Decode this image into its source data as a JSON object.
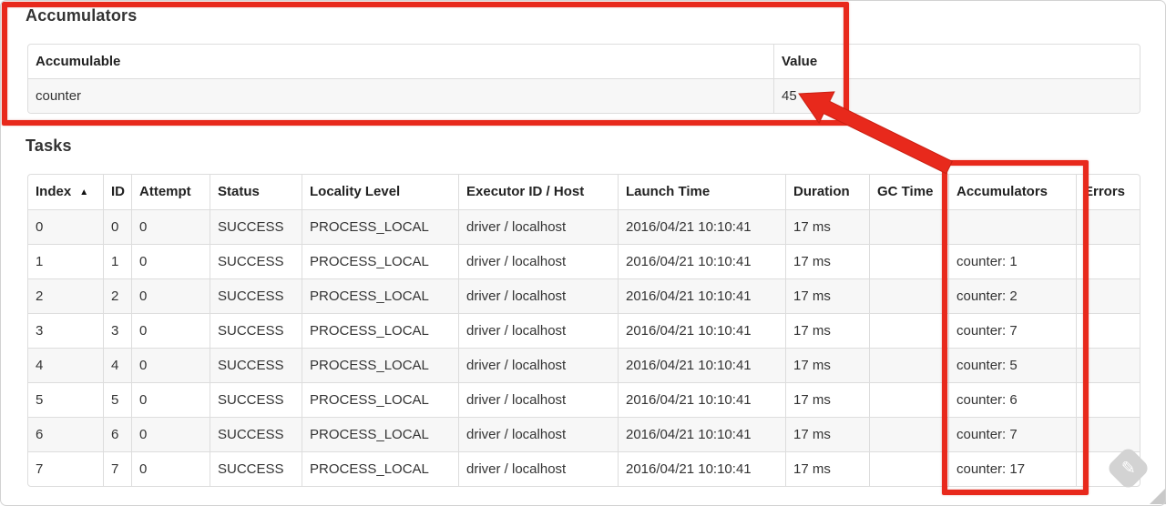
{
  "annotation_color": "#e8291c",
  "accumulators_section": {
    "title": "Accumulators",
    "table": {
      "columns": [
        "Accumulable",
        "Value"
      ],
      "rows": [
        [
          "counter",
          "45"
        ]
      ]
    }
  },
  "tasks_section": {
    "title": "Tasks",
    "table": {
      "columns": [
        "Index",
        "ID",
        "Attempt",
        "Status",
        "Locality Level",
        "Executor ID / Host",
        "Launch Time",
        "Duration",
        "GC Time",
        "Accumulators",
        "Errors"
      ],
      "sort": {
        "column": "Index",
        "direction": "asc",
        "icon": "▲"
      },
      "rows": [
        [
          "0",
          "0",
          "0",
          "SUCCESS",
          "PROCESS_LOCAL",
          "driver / localhost",
          "2016/04/21 10:10:41",
          "17 ms",
          "",
          "",
          ""
        ],
        [
          "1",
          "1",
          "0",
          "SUCCESS",
          "PROCESS_LOCAL",
          "driver / localhost",
          "2016/04/21 10:10:41",
          "17 ms",
          "",
          "counter: 1",
          ""
        ],
        [
          "2",
          "2",
          "0",
          "SUCCESS",
          "PROCESS_LOCAL",
          "driver / localhost",
          "2016/04/21 10:10:41",
          "17 ms",
          "",
          "counter: 2",
          ""
        ],
        [
          "3",
          "3",
          "0",
          "SUCCESS",
          "PROCESS_LOCAL",
          "driver / localhost",
          "2016/04/21 10:10:41",
          "17 ms",
          "",
          "counter: 7",
          ""
        ],
        [
          "4",
          "4",
          "0",
          "SUCCESS",
          "PROCESS_LOCAL",
          "driver / localhost",
          "2016/04/21 10:10:41",
          "17 ms",
          "",
          "counter: 5",
          ""
        ],
        [
          "5",
          "5",
          "0",
          "SUCCESS",
          "PROCESS_LOCAL",
          "driver / localhost",
          "2016/04/21 10:10:41",
          "17 ms",
          "",
          "counter: 6",
          ""
        ],
        [
          "6",
          "6",
          "0",
          "SUCCESS",
          "PROCESS_LOCAL",
          "driver / localhost",
          "2016/04/21 10:10:41",
          "17 ms",
          "",
          "counter: 7",
          ""
        ],
        [
          "7",
          "7",
          "0",
          "SUCCESS",
          "PROCESS_LOCAL",
          "driver / localhost",
          "2016/04/21 10:10:41",
          "17 ms",
          "",
          "counter: 17",
          ""
        ]
      ]
    }
  }
}
